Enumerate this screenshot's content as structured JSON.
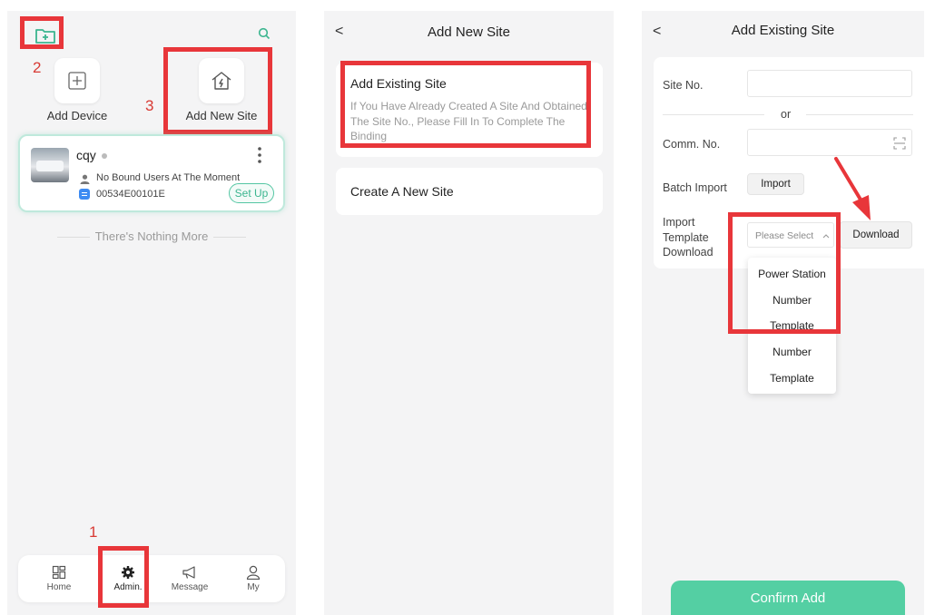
{
  "colors": {
    "accent": "#54cfa3",
    "annotation": "#e8363a",
    "panel_bg": "#f4f4f5"
  },
  "annotations": [
    "1",
    "2",
    "3"
  ],
  "panel1": {
    "icons": {
      "folder_add": "folder-plus-icon",
      "search": "search-icon",
      "add_device": "plus-square-icon",
      "add_site": "house-bolt-icon"
    },
    "add_device_label": "Add Device",
    "add_new_site_label": "Add New Site",
    "site": {
      "name": "cqy",
      "users": "No Bound Users At The Moment",
      "serial": "00534E00101E",
      "setup": "Set Up"
    },
    "nothing_more": "There's Nothing More",
    "tabs": [
      {
        "label": "Home",
        "icon": "home-grid-icon"
      },
      {
        "label": "Admin.",
        "icon": "gear-icon",
        "active": true
      },
      {
        "label": "Message",
        "icon": "megaphone-icon"
      },
      {
        "label": "My",
        "icon": "user-icon"
      }
    ]
  },
  "panel2": {
    "title": "Add New Site",
    "back": "<",
    "existing": {
      "title": "Add Existing Site",
      "desc": "If You Have Already Created A Site And Obtained The Site No., Please Fill In To Complete The Binding"
    },
    "create": {
      "title": "Create A New Site"
    }
  },
  "panel3": {
    "title": "Add Existing Site",
    "back": "<",
    "site_no_label": "Site No.",
    "or": "or",
    "comm_no_label": "Comm. No.",
    "batch_label": "Batch Import",
    "import_btn": "Import",
    "template_label": "Import Template Download",
    "select_placeholder": "Please Select",
    "download_btn": "Download",
    "options": [
      "Power Station",
      "Number",
      "Template",
      "Number",
      "Template"
    ],
    "confirm": "Confirm Add"
  }
}
